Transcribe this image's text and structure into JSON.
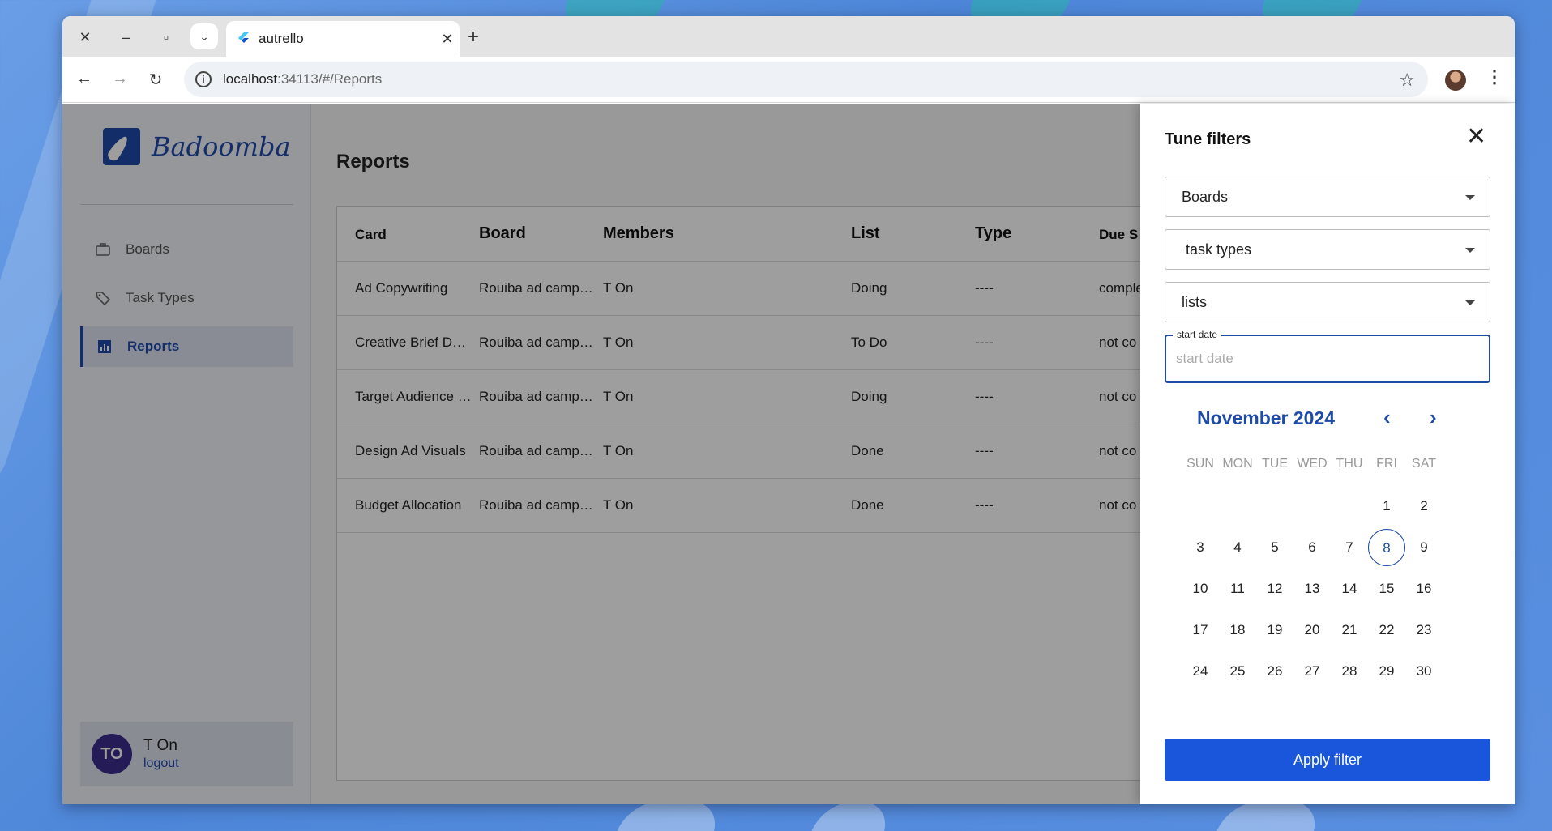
{
  "browser": {
    "tab_title": "autrello",
    "url_host": "localhost",
    "url_path": ":34113/#/Reports"
  },
  "app": {
    "logo_text": "Badoomba",
    "sidebar": {
      "items": [
        {
          "label": "Boards",
          "icon": "briefcase-icon"
        },
        {
          "label": "Task Types",
          "icon": "tag-icon"
        },
        {
          "label": "Reports",
          "icon": "bar-chart-icon",
          "active": true
        }
      ],
      "user": {
        "initials": "TO",
        "name": "T On",
        "logout": "logout"
      }
    },
    "page_title": "Reports",
    "table": {
      "columns": [
        "Card",
        "Board",
        "Members",
        "List",
        "Type",
        "Due S"
      ],
      "rows": [
        {
          "card": "Ad Copywriting",
          "board": "Rouiba ad camp…",
          "members": "T On",
          "list": "Doing",
          "type": "----",
          "due": "comple"
        },
        {
          "card": "Creative Brief De…",
          "board": "Rouiba ad camp…",
          "members": "T On",
          "list": "To Do",
          "type": "----",
          "due": "not co"
        },
        {
          "card": "Target Audience …",
          "board": "Rouiba ad camp…",
          "members": "T On",
          "list": "Doing",
          "type": "----",
          "due": "not co"
        },
        {
          "card": "Design Ad Visuals",
          "board": "Rouiba ad camp…",
          "members": "T On",
          "list": "Done",
          "type": "----",
          "due": "not co"
        },
        {
          "card": "Budget Allocation",
          "board": "Rouiba ad camp…",
          "members": "T On",
          "list": "Done",
          "type": "----",
          "due": "not co"
        }
      ]
    },
    "filters": {
      "title": "Tune filters",
      "boards": "Boards",
      "task_types": "task types",
      "lists": "lists",
      "start_date_label": "start date",
      "start_date_placeholder": "start date",
      "calendar": {
        "month": "November 2024",
        "weekdays": [
          "SUN",
          "MON",
          "TUE",
          "WED",
          "THU",
          "FRI",
          "SAT"
        ],
        "first_weekday_index": 5,
        "days_in_month": 30,
        "today": 8
      },
      "apply": "Apply filter"
    }
  }
}
